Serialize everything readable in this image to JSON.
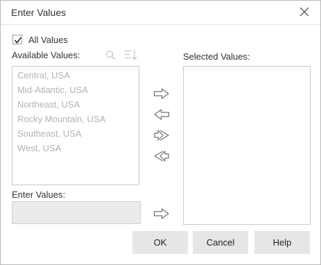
{
  "dialog": {
    "title": "Enter Values"
  },
  "all_values": {
    "label": "All Values",
    "checked": true
  },
  "available": {
    "label": "Available Values:",
    "items": [
      "Central, USA",
      "Mid-Atlantic, USA",
      "Northeast, USA",
      "Rocky Mountain, USA",
      "Southeast, USA",
      "West, USA"
    ]
  },
  "selected": {
    "label": "Selected Values:"
  },
  "enter": {
    "label": "Enter Values:",
    "value": ""
  },
  "icons": {
    "close": "close-icon",
    "search": "search-icon",
    "sort": "sort-icon",
    "add": "arrow-right-icon",
    "remove": "arrow-left-icon",
    "add_all": "double-arrow-right-icon",
    "remove_all": "double-arrow-left-icon",
    "add_entered": "arrow-right-icon"
  },
  "buttons": {
    "ok": "OK",
    "cancel": "Cancel",
    "help": "Help"
  }
}
